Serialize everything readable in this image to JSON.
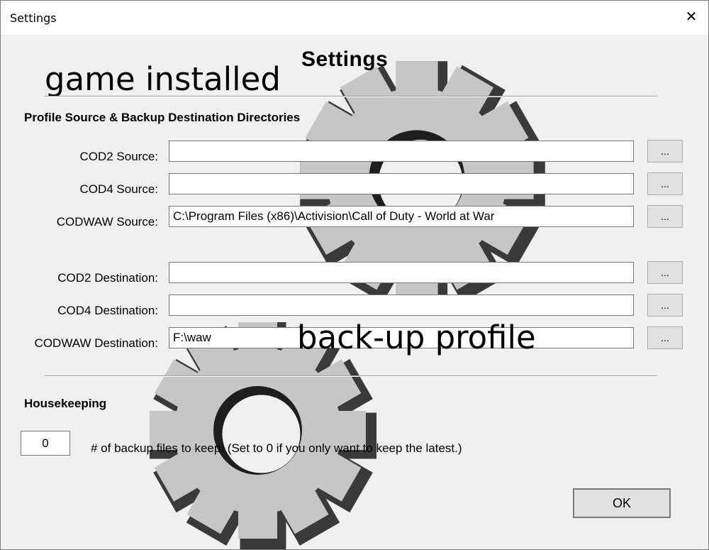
{
  "window": {
    "title": "Settings",
    "close_glyph": "✕"
  },
  "heading": "Settings",
  "annotations": {
    "game_installed": "game installed",
    "backup_profile": "back-up profile"
  },
  "profile_section": {
    "label": "Profile Source & Backup Destination Directories",
    "browse_label": "...",
    "rows": [
      {
        "label": "COD2 Source:",
        "value": ""
      },
      {
        "label": "COD4 Source:",
        "value": ""
      },
      {
        "label": "CODWAW Source:",
        "value": "C:\\Program Files (x86)\\Activision\\Call of Duty - World at War"
      },
      {
        "label": "COD2 Destination:",
        "value": ""
      },
      {
        "label": "COD4 Destination:",
        "value": ""
      },
      {
        "label": "CODWAW Destination:",
        "value": "F:\\waw"
      }
    ]
  },
  "housekeeping": {
    "label": "Housekeeping",
    "backup_count": "0",
    "description": "# of backup files to keep. (Set to 0 if you only want to keep the latest.)"
  },
  "ok_label": "OK",
  "colors": {
    "window_bg": "#f0f0f0",
    "gear_light": "#c4c4c4",
    "gear_dark": "#2c2c2c"
  }
}
